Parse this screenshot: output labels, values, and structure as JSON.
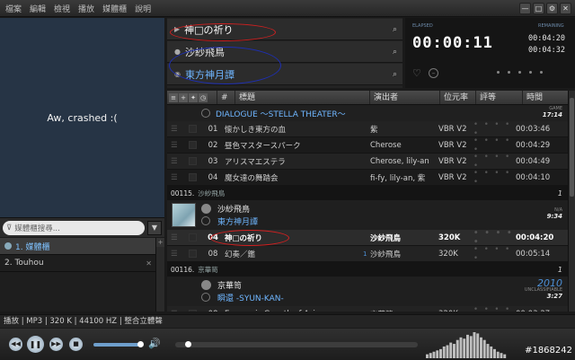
{
  "menu": [
    "檔案",
    "編輯",
    "檢視",
    "播放",
    "媒體櫃",
    "說明"
  ],
  "window_buttons": [
    "—",
    "□",
    "⚙",
    "✕"
  ],
  "crash_message": "Aw, crashed :(",
  "left_search": {
    "placeholder": "媒體櫃搜尋..."
  },
  "playlists": [
    {
      "label": "1. 媒體櫃",
      "active": true
    },
    {
      "label": "2. Touhou",
      "active": false
    }
  ],
  "now_playing": {
    "track": "神□の祈り",
    "artist": "沙紗飛鳥",
    "album": "東方神月譚"
  },
  "timer": {
    "elapsed_label": "ELAPSED",
    "remaining_label": "REMAINING",
    "elapsed": "00:00:11",
    "remaining": "00:04:20",
    "total": "00:04:32"
  },
  "columns": {
    "num": "#",
    "title": "標題",
    "artist": "演出者",
    "bitrate": "位元率",
    "rating": "評等",
    "time": "時間"
  },
  "album1": {
    "title": "DIALOGUE ～STELLA THEATER～",
    "genre": "GAME",
    "duration": "17:14"
  },
  "album1_tracks": [
    {
      "num": "01",
      "title": "懐かしき東方の血",
      "artist": "紫",
      "bitrate": "VBR V2",
      "rating": "• • • • •",
      "time": "00:03:46"
    },
    {
      "num": "02",
      "title": "昼色マスタースパーク",
      "artist": "Cherose",
      "bitrate": "VBR V2",
      "rating": "• • • • •",
      "time": "00:04:29"
    },
    {
      "num": "03",
      "title": "アリスマエステラ",
      "artist": "Cherose, lily-an",
      "bitrate": "VBR V2",
      "rating": "• • • • •",
      "time": "00:04:49"
    },
    {
      "num": "04",
      "title": "魔女達の舞踏会",
      "artist": "fi-fy, lily-an, 紫",
      "bitrate": "VBR V2",
      "rating": "• • • • •",
      "time": "00:04:10"
    }
  ],
  "group2": {
    "id": "00115.",
    "name": "沙紗飛鳥",
    "count": "1"
  },
  "album2": {
    "artist": "沙紗飛鳥",
    "title": "東方神月譚",
    "genre": "N/A",
    "duration": "9:34"
  },
  "album2_tracks": [
    {
      "num": "04",
      "title": "神□の祈り",
      "artist": "沙紗飛鳥",
      "bitrate": "320K",
      "rating": "• • • • •",
      "time": "00:04:20",
      "extra": ""
    },
    {
      "num": "08",
      "title": "幻奏／鑑",
      "artist": "沙紗飛鳥",
      "bitrate": "320K",
      "rating": "• • • • •",
      "time": "00:05:14",
      "extra": "1"
    }
  ],
  "group3": {
    "id": "00116.",
    "name": "京華笥",
    "count": "1"
  },
  "album3": {
    "artist": "京華笥",
    "title": "瞬還 -SYUN-KAN-",
    "year": "2010",
    "genre": "UNCLASSIFIABLE",
    "duration": "3:27"
  },
  "album3_tracks": [
    {
      "num": "08",
      "title": "Economic Growth of Asia",
      "artist": "京華笥",
      "bitrate": "320K",
      "rating": "• • • • •",
      "time": "00:03:27"
    }
  ],
  "status": "播放 | MP3 | 320 K | 44100 HZ | 整合立體聲",
  "playback": {
    "volume": 0.92,
    "position": 0.04
  },
  "watermark": "#1868242",
  "spectrum_levels": [
    0.15,
    0.2,
    0.25,
    0.3,
    0.35,
    0.45,
    0.5,
    0.6,
    0.55,
    0.7,
    0.8,
    0.75,
    0.9,
    0.85,
    1.0,
    0.95,
    0.8,
    0.7,
    0.55,
    0.45,
    0.35,
    0.25,
    0.2,
    0.15
  ],
  "colors": {
    "accent": "#6fb6ff",
    "crash_bg": "#263445",
    "annotation_red": "#d02020",
    "annotation_blue": "#1e2fb0"
  }
}
